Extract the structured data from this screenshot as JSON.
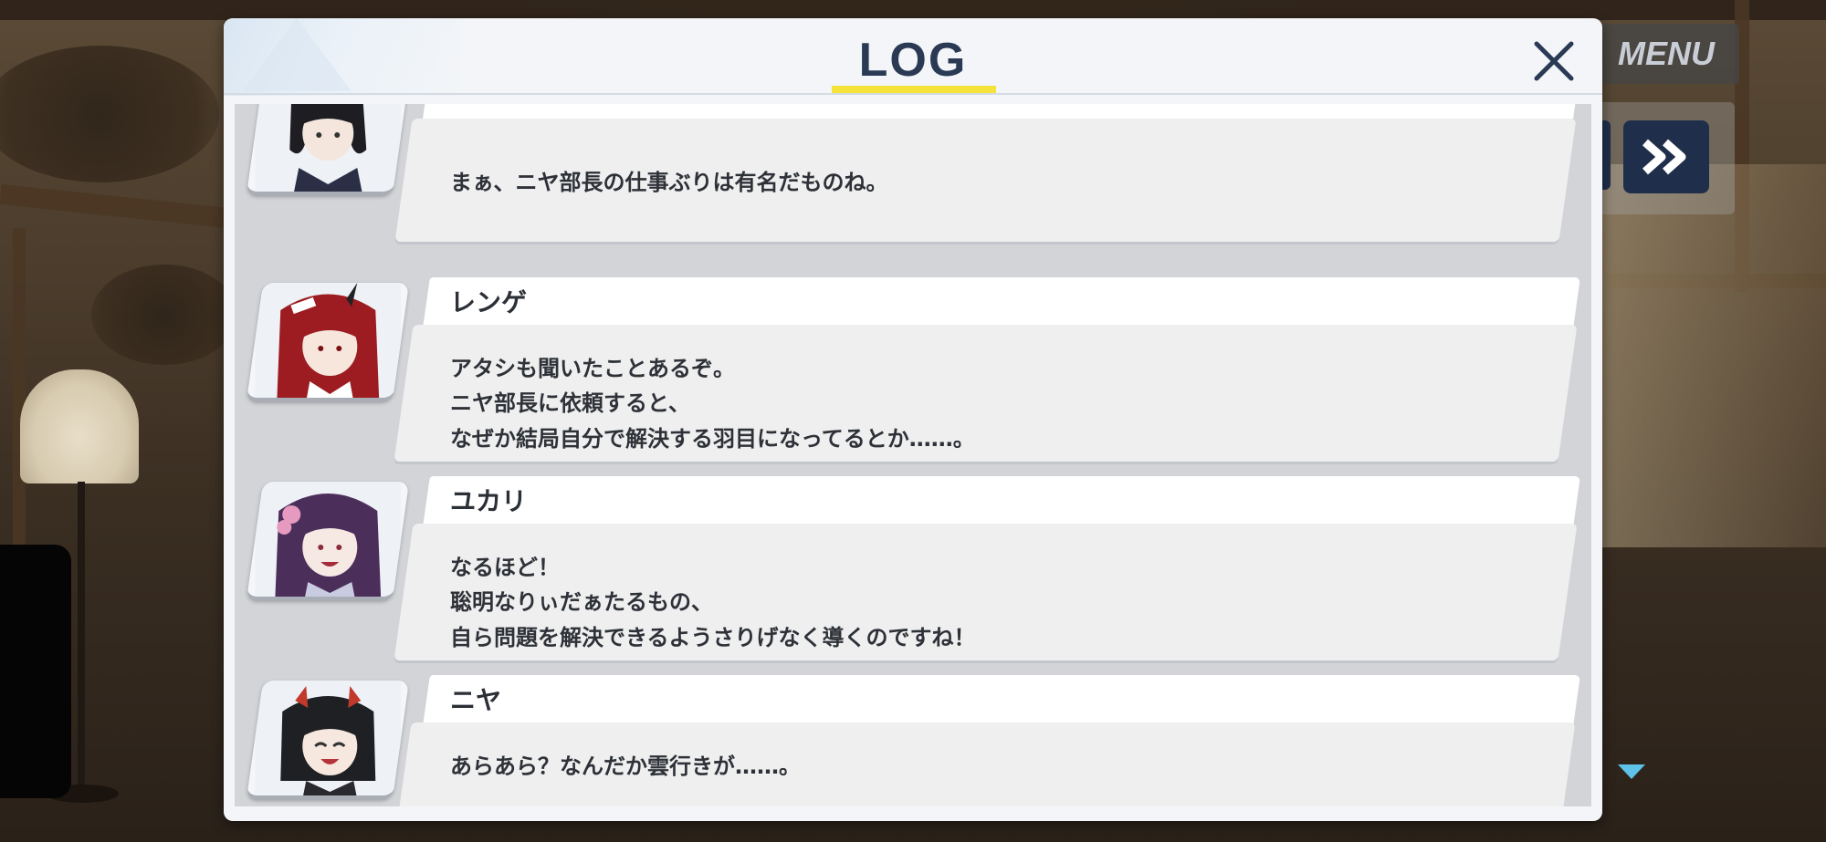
{
  "game_ui": {
    "menu_label": "MENU",
    "auto_icon": "auto-icon",
    "skip_icon": "fast-forward-icon",
    "scroll_indicator_icon": "scroll-down-triangle-icon"
  },
  "dialog": {
    "title": "LOG",
    "close_icon": "close-x-icon",
    "accent_color": "#f5e33a",
    "title_color": "#2a3a55"
  },
  "log_entries": [
    {
      "speaker": "",
      "portrait": "black-bob-hair-character",
      "lines": [
        "まぁ、ニヤ部長の仕事ぶりは有名だものね。"
      ]
    },
    {
      "speaker": "レンゲ",
      "portrait": "red-hair-horned-character",
      "lines": [
        "アタシも聞いたことあるぞ。",
        "ニヤ部長に依頼すると、",
        "なぜか結局自分で解決する羽目になってるとか……。"
      ]
    },
    {
      "speaker": "ユカリ",
      "portrait": "purple-hair-flower-character",
      "lines": [
        "なるほど！",
        "聡明なりぃだぁたるもの、",
        "自ら問題を解決できるようさりげなく導くのですね！"
      ]
    },
    {
      "speaker": "ニヤ",
      "portrait": "black-hair-horned-smiling-character",
      "lines": [
        "あらあら？なんだか雲行きが……。"
      ]
    }
  ]
}
